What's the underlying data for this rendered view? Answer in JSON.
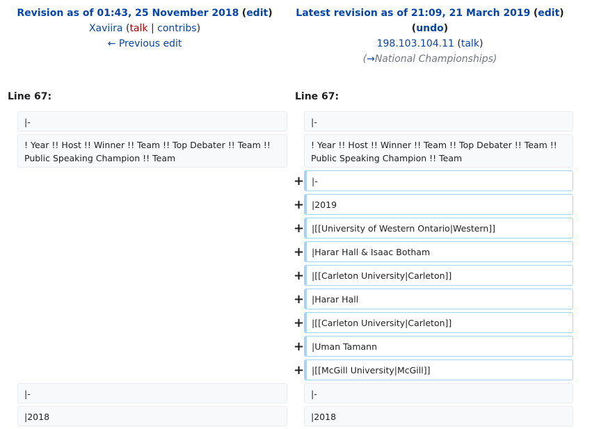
{
  "left": {
    "title": "Revision as of 01:43, 25 November 2018",
    "edit": "edit",
    "user": "Xaviira",
    "talk": "talk",
    "contribs": "contribs",
    "prev": "← Previous edit",
    "line": "Line 67:"
  },
  "right": {
    "title": "Latest revision as of 21:09, 21 March 2019",
    "edit": "edit",
    "undo": "undo",
    "user": "198.103.104.11",
    "talk": "talk",
    "summary_arrow": "→",
    "summary": "National Championships",
    "line": "Line 67:"
  },
  "context_top": [
    "|-",
    "! Year !! Host !! Winner !! Team !! Top Debater !! Team !! Public Speaking Champion !! Team"
  ],
  "added": [
    "|-",
    "|2019",
    "|[[University of Western Ontario|Western]]",
    "|Harar Hall & Isaac Botham",
    "|[[Carleton University|Carleton]]",
    "|Harar Hall",
    "|[[Carleton University|Carleton]]",
    "|Uman Tamann",
    "|[[McGill University|McGill]]"
  ],
  "context_bottom": [
    "|-",
    "|2018"
  ],
  "marker": "+"
}
